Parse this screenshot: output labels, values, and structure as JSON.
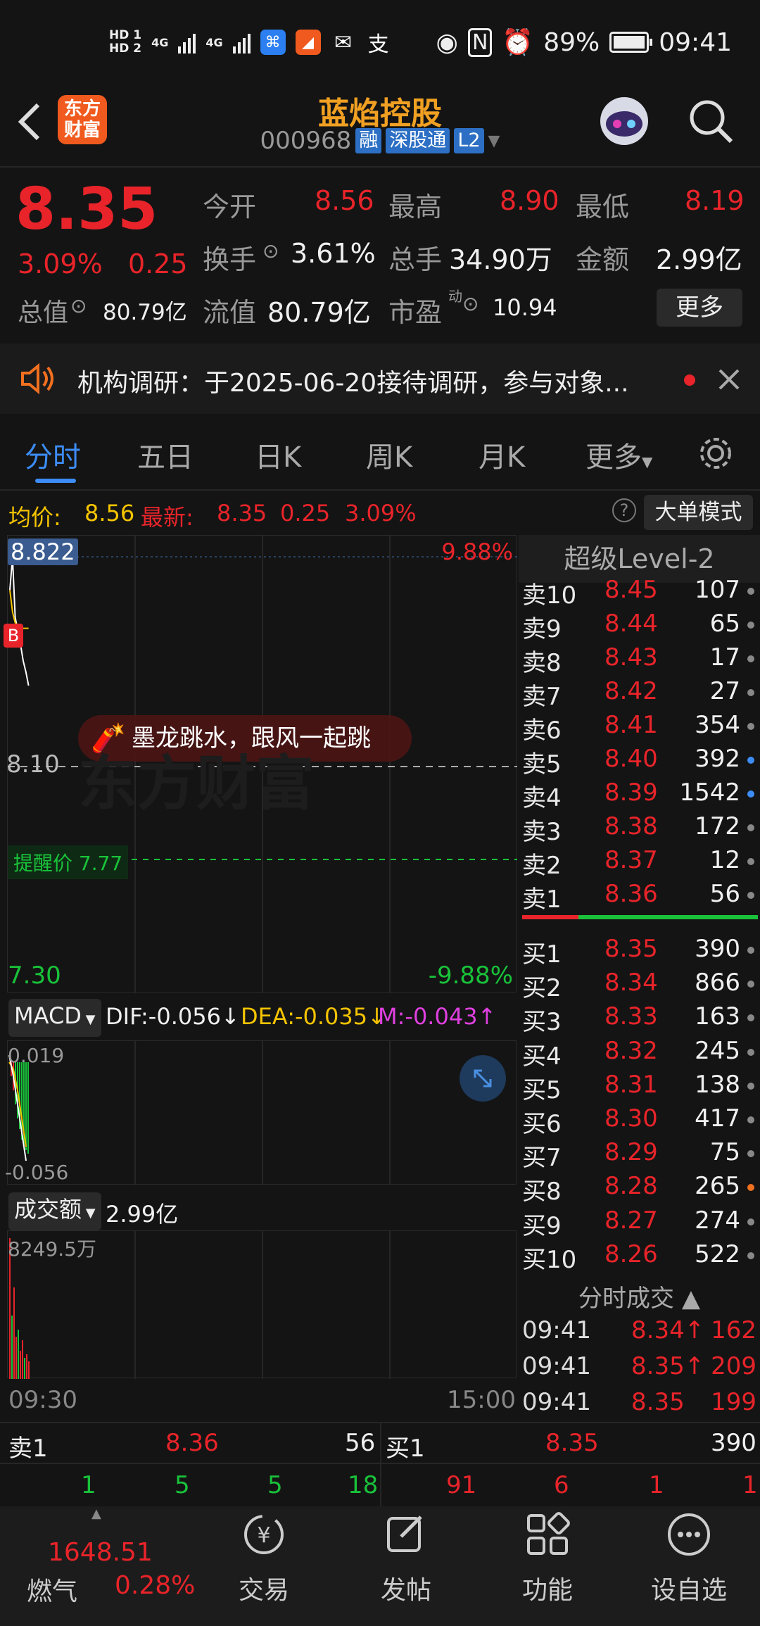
{
  "status_bar": {
    "hd1": "HD 1",
    "hd2": "HD 2",
    "net1": "4G",
    "net2": "4G",
    "battery": "89%",
    "time": "09:41"
  },
  "header": {
    "title": "蓝焰控股",
    "code": "000968",
    "tags": [
      "融",
      "深股通",
      "L2"
    ],
    "logo_line1": "东方",
    "logo_line2": "财富"
  },
  "quote": {
    "price": "8.35",
    "change_pct": "3.09%",
    "change": "0.25",
    "open_label": "今开",
    "open": "8.56",
    "high_label": "最高",
    "high": "8.90",
    "low_label": "最低",
    "low": "8.19",
    "turnover_label": "换手",
    "turnover": "3.61%",
    "volume_label": "总手",
    "volume": "34.90万",
    "amount_label": "金额",
    "amount": "2.99亿",
    "mktcap_label": "总值",
    "mktcap": "80.79亿",
    "float_label": "流值",
    "float": "80.79亿",
    "pe_label": "市盈",
    "pe_sup": "动",
    "pe": "10.94",
    "more": "更多"
  },
  "notice": {
    "text": "机构调研：于2025-06-20接待调研，参与对象..."
  },
  "tabs": [
    "分时",
    "五日",
    "日K",
    "周K",
    "月K",
    "更多"
  ],
  "avg_line": {
    "avg_label": "均价:",
    "avg": "8.56",
    "last_label": "最新:",
    "last": "8.35",
    "chg": "0.25",
    "pct": "3.09%",
    "mode_button": "大单模式"
  },
  "chart": {
    "top_price": "8.822",
    "top_pct": "9.88%",
    "mid_price": "8.10",
    "low_price": "7.30",
    "low_pct": "-9.88%",
    "alert_label": "提醒价 7.77",
    "promo": "墨龙跳水，跟风一起跳",
    "watermark": "东方财富",
    "b_marker": "B"
  },
  "chart_data": {
    "type": "line",
    "title": "",
    "y_range": [
      7.3,
      8.822
    ],
    "reference": 8.1,
    "alert_price": 7.77,
    "x_range": [
      "09:30",
      "15:00"
    ],
    "price_series": [
      8.7,
      8.82,
      8.6,
      8.55,
      8.5,
      8.44,
      8.4,
      8.35
    ],
    "avg_series": [
      8.7,
      8.62,
      8.58,
      8.57,
      8.56,
      8.56,
      8.56,
      8.56
    ]
  },
  "macd": {
    "selector": "MACD",
    "dif": "DIF:-0.056↓",
    "dea": "DEA:-0.035↓",
    "m": "M:-0.043↑",
    "top": "0.019",
    "bottom": "-0.056"
  },
  "volume": {
    "selector": "成交额",
    "value": "2.99亿",
    "max": "8249.5万",
    "start_time": "09:30",
    "end_time": "15:00"
  },
  "orderbook": {
    "title": "超级Level-2",
    "asks": [
      {
        "label": "卖10",
        "price": "8.45",
        "vol": "107"
      },
      {
        "label": "卖9",
        "price": "8.44",
        "vol": "65"
      },
      {
        "label": "卖8",
        "price": "8.43",
        "vol": "17"
      },
      {
        "label": "卖7",
        "price": "8.42",
        "vol": "27"
      },
      {
        "label": "卖6",
        "price": "8.41",
        "vol": "354"
      },
      {
        "label": "卖5",
        "price": "8.40",
        "vol": "392"
      },
      {
        "label": "卖4",
        "price": "8.39",
        "vol": "1542"
      },
      {
        "label": "卖3",
        "price": "8.38",
        "vol": "172"
      },
      {
        "label": "卖2",
        "price": "8.37",
        "vol": "12"
      },
      {
        "label": "卖1",
        "price": "8.36",
        "vol": "56"
      }
    ],
    "bids": [
      {
        "label": "买1",
        "price": "8.35",
        "vol": "390"
      },
      {
        "label": "买2",
        "price": "8.34",
        "vol": "866"
      },
      {
        "label": "买3",
        "price": "8.33",
        "vol": "163"
      },
      {
        "label": "买4",
        "price": "8.32",
        "vol": "245"
      },
      {
        "label": "买5",
        "price": "8.31",
        "vol": "138"
      },
      {
        "label": "买6",
        "price": "8.30",
        "vol": "417"
      },
      {
        "label": "买7",
        "price": "8.29",
        "vol": "75"
      },
      {
        "label": "买8",
        "price": "8.28",
        "vol": "265"
      },
      {
        "label": "买9",
        "price": "8.27",
        "vol": "274"
      },
      {
        "label": "买10",
        "price": "8.26",
        "vol": "522"
      }
    ],
    "ticks_title": "分时成交",
    "ticks": [
      {
        "time": "09:41",
        "price": "8.34↑",
        "vol": "162"
      },
      {
        "time": "09:41",
        "price": "8.35↑",
        "vol": "209"
      },
      {
        "time": "09:41",
        "price": "8.35",
        "vol": "199"
      }
    ]
  },
  "bottom_quote": {
    "ask1_label": "卖1",
    "ask1_price": "8.36",
    "ask1_vol": "56",
    "bid1_label": "买1",
    "bid1_price": "8.35",
    "bid1_vol": "390",
    "green_counts": [
      "1",
      "5",
      "5",
      "18"
    ],
    "red_counts": [
      "91",
      "6",
      "1",
      "1"
    ]
  },
  "nav": {
    "index_value": "1648.51",
    "index_name": "燃气",
    "index_pct": "0.28%",
    "items": [
      "交易",
      "发帖",
      "功能",
      "设自选"
    ]
  },
  "colors": {
    "up": "#e8242a",
    "down": "#19c23a",
    "accent": "#3d8cf5",
    "title": "#f0a022"
  }
}
